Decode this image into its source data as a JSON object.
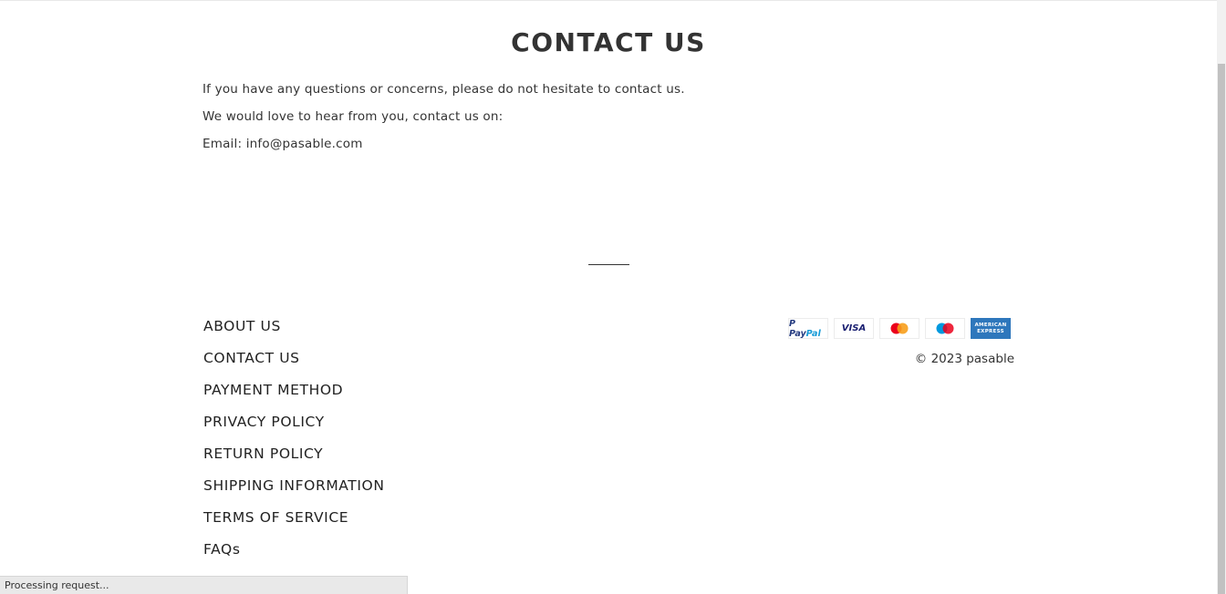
{
  "page": {
    "title": "CONTACT US",
    "paragraphs": [
      "If you have any questions or concerns, please do not hesitate to contact us.",
      "We would love to hear from you, contact us on:",
      "Email: info@pasable.com"
    ]
  },
  "footer": {
    "nav": [
      {
        "label": "ABOUT US"
      },
      {
        "label": "CONTACT US"
      },
      {
        "label": "PAYMENT METHOD"
      },
      {
        "label": "PRIVACY POLICY"
      },
      {
        "label": "RETURN POLICY"
      },
      {
        "label": "SHIPPING INFORMATION"
      },
      {
        "label": "TERMS OF SERVICE"
      },
      {
        "label": "FAQs"
      }
    ],
    "payment_icons": [
      {
        "name": "paypal-icon",
        "text_a": "P Pay",
        "text_b": "Pal"
      },
      {
        "name": "visa-icon",
        "text": "VISA"
      },
      {
        "name": "mastercard-icon",
        "colors": [
          "#eb001b",
          "#f79e1b"
        ]
      },
      {
        "name": "maestro-icon",
        "colors": [
          "#0099df",
          "#eb001b"
        ]
      },
      {
        "name": "amex-icon",
        "line1": "AMERICAN",
        "line2": "EXPRESS"
      }
    ],
    "copyright": "© 2023 pasable"
  },
  "status_bar": {
    "text": "Processing request..."
  }
}
